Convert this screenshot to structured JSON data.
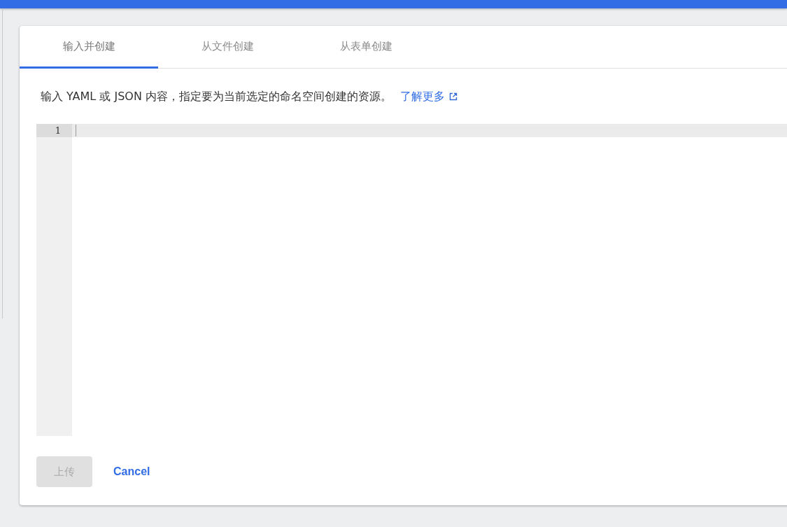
{
  "tabs": [
    {
      "label": "输入并创建",
      "selected": true
    },
    {
      "label": "从文件创建",
      "selected": false
    },
    {
      "label": "从表单创建",
      "selected": false
    }
  ],
  "description": {
    "text": "输入 YAML 或 JSON 内容，指定要为当前选定的命名空间创建的资源。",
    "link": "了解更多"
  },
  "editor": {
    "lines": [
      {
        "number": "1",
        "active": true
      }
    ]
  },
  "buttons": [
    {
      "kind": "primary",
      "label": "上传",
      "disabled": true
    },
    {
      "kind": "text",
      "label": "Cancel",
      "disabled": false
    }
  ]
}
